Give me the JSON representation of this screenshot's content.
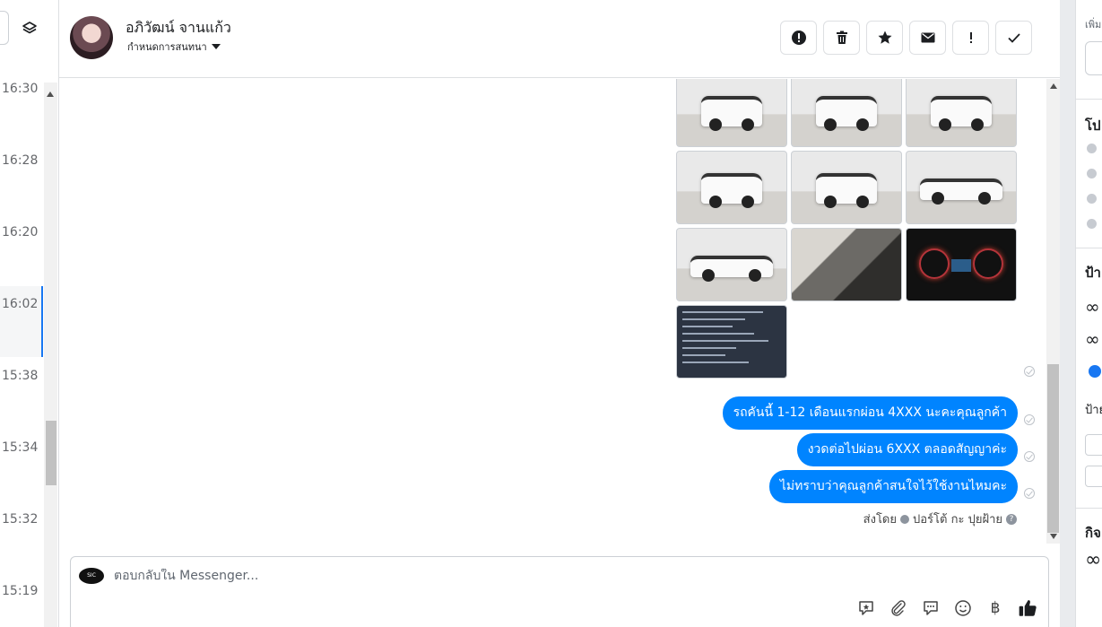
{
  "conversation_list": {
    "times": [
      "16:30",
      "16:28",
      "16:20",
      "16:02",
      "15:38",
      "15:34",
      "15:32",
      "15:19"
    ],
    "active_index": 3
  },
  "header": {
    "contact_name": "อภิวัฒน์ จานแก้ว",
    "assign_label": "กำหนดการสนทนา",
    "actions": [
      {
        "name": "report-spam-button",
        "icon": "alert-circle-icon"
      },
      {
        "name": "delete-button",
        "icon": "trash-icon"
      },
      {
        "name": "star-button",
        "icon": "star-icon"
      },
      {
        "name": "mark-unread-button",
        "icon": "envelope-icon"
      },
      {
        "name": "mark-important-button",
        "icon": "exclamation-icon"
      },
      {
        "name": "mark-done-button",
        "icon": "check-icon"
      }
    ]
  },
  "thread": {
    "photos": [
      "car-front-left",
      "car-front",
      "car-rear-left",
      "car-rear",
      "car-rear-right",
      "car-side-right",
      "car-side-left",
      "car-interior",
      "car-gauge",
      "document-screenshot"
    ],
    "messages": [
      "รถคันนี้ 1-12 เดือนแรกผ่อน 4XXX นะคะคุณลูกค้า",
      "งวดต่อไปผ่อน 6XXX  ตลอดสัญญาค่ะ",
      "ไม่ทราบว่าคุณลูกค้าสนใจไว้ใช้งานไหมคะ"
    ],
    "sent_by_prefix": "ส่งโดย",
    "sent_by_name": "ปอร์โต้ กะ ปุยฝ้าย"
  },
  "composer": {
    "placeholder": "ตอบกลับใน Messenger...",
    "tools": [
      "saved-reply-icon",
      "attachment-icon",
      "chat-bubble-icon",
      "emoji-icon",
      "baht-icon",
      "thumbs-up-icon"
    ]
  },
  "right_panel": {
    "top_label": "เพิ่ม",
    "section_title": "โป",
    "labels_title": "ป้า",
    "label_text": "ป้าย",
    "activity_title": "กิจ",
    "infinity": "∞"
  },
  "colors": {
    "accent": "#0084ff",
    "border": "#dddfe2",
    "muted": "#65676b"
  }
}
